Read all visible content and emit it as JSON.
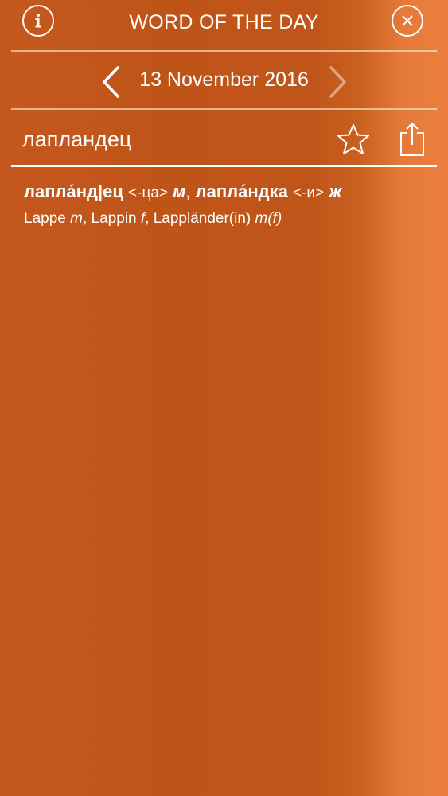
{
  "header": {
    "title": "WORD OF THE DAY",
    "info_icon": "info-icon",
    "close_icon": "close-icon"
  },
  "date_nav": {
    "date": "13 November 2016",
    "prev_icon": "chevron-left-icon",
    "next_icon": "chevron-right-icon"
  },
  "search": {
    "word": "лапландец",
    "favorite_icon": "star-icon",
    "share_icon": "share-icon"
  },
  "entry": {
    "headword1": "лапла́нд|ец",
    "gram1": "<-ца>",
    "gender1": "м",
    "sep": ",",
    "headword2": "лапла́ндка",
    "gram2": "<-и>",
    "gender2": "ж",
    "tr1": "Lappe",
    "tr1_gender": "m",
    "tr2": "Lappin",
    "tr2_gender": "f",
    "tr3": "Lappländer(in)",
    "tr3_gender": "m(f)"
  },
  "colors": {
    "background": "#c05519",
    "background_right": "#ec7f3e",
    "foreground": "#ffffff"
  }
}
